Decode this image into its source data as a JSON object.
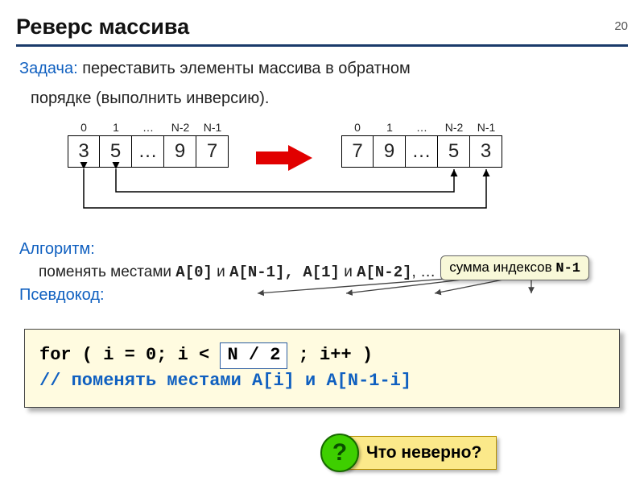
{
  "page_number": "20",
  "title": "Реверс массива",
  "task": {
    "label": "Задача:",
    "text1": " переставить элементы массива в обратном",
    "text2": "порядке (выполнить инверсию)."
  },
  "diagram": {
    "indices": [
      "0",
      "1",
      "…",
      "N-2",
      "N-1"
    ],
    "left": [
      "3",
      "5",
      "…",
      "9",
      "7"
    ],
    "right": [
      "7",
      "9",
      "…",
      "5",
      "3"
    ]
  },
  "algorithm": {
    "label": "Алгоритм:",
    "prefix": "поменять местами ",
    "p1a": "A[0]",
    "and1": " и ",
    "p1b": "A[N-1]",
    "sep": ", ",
    "p2a": "A[1]",
    "and2": " и ",
    "p2b": "A[N-2]",
    "suffix": ", …"
  },
  "callout": {
    "text": "сумма индексов ",
    "expr": "N-1"
  },
  "pseudocode_label": "Псевдокод:",
  "code": {
    "line1a": "for ( i = 0; i < ",
    "highlight": "N / 2",
    "line1b": " ; i++ )",
    "line2": " // поменять местами A[i] и A[N-1-i]"
  },
  "footer": {
    "qmark": "?",
    "text": "Что неверно?"
  }
}
